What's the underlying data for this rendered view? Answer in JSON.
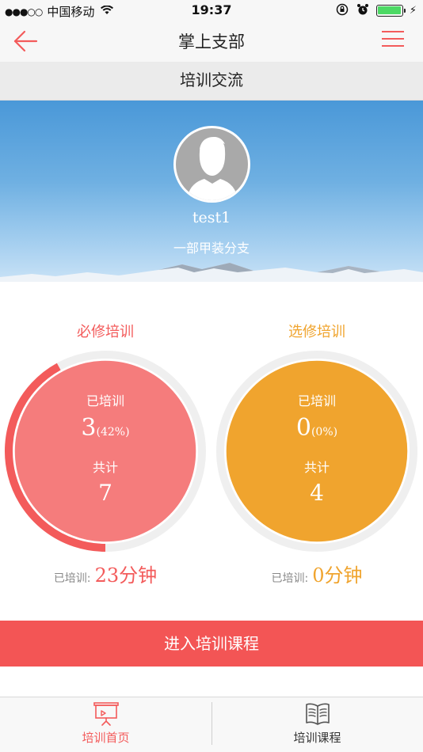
{
  "status_bar": {
    "carrier": "中国移动",
    "time": "19:37"
  },
  "nav": {
    "title": "掌上支部"
  },
  "section_header": "培训交流",
  "profile": {
    "username": "test1",
    "branch": "一部甲装分支"
  },
  "required": {
    "title": "必修培训",
    "trained_label": "已培训",
    "trained_count": "3",
    "trained_percent": "(42%)",
    "progress": 0.42,
    "total_label": "共计",
    "total": "7",
    "foot_label": "已培训:",
    "foot_value": "23分钟"
  },
  "elective": {
    "title": "选修培训",
    "trained_label": "已培训",
    "trained_count": "0",
    "trained_percent": "(0%)",
    "progress": 0,
    "total_label": "共计",
    "total": "4",
    "foot_label": "已培训:",
    "foot_value": "0分钟"
  },
  "enter_button": "进入培训课程",
  "tabs": {
    "home": "培训首页",
    "course": "培训课程"
  },
  "colors": {
    "accent_red": "#f35b5b",
    "accent_orange": "#f0a42e",
    "battery_green": "#4cd964"
  }
}
